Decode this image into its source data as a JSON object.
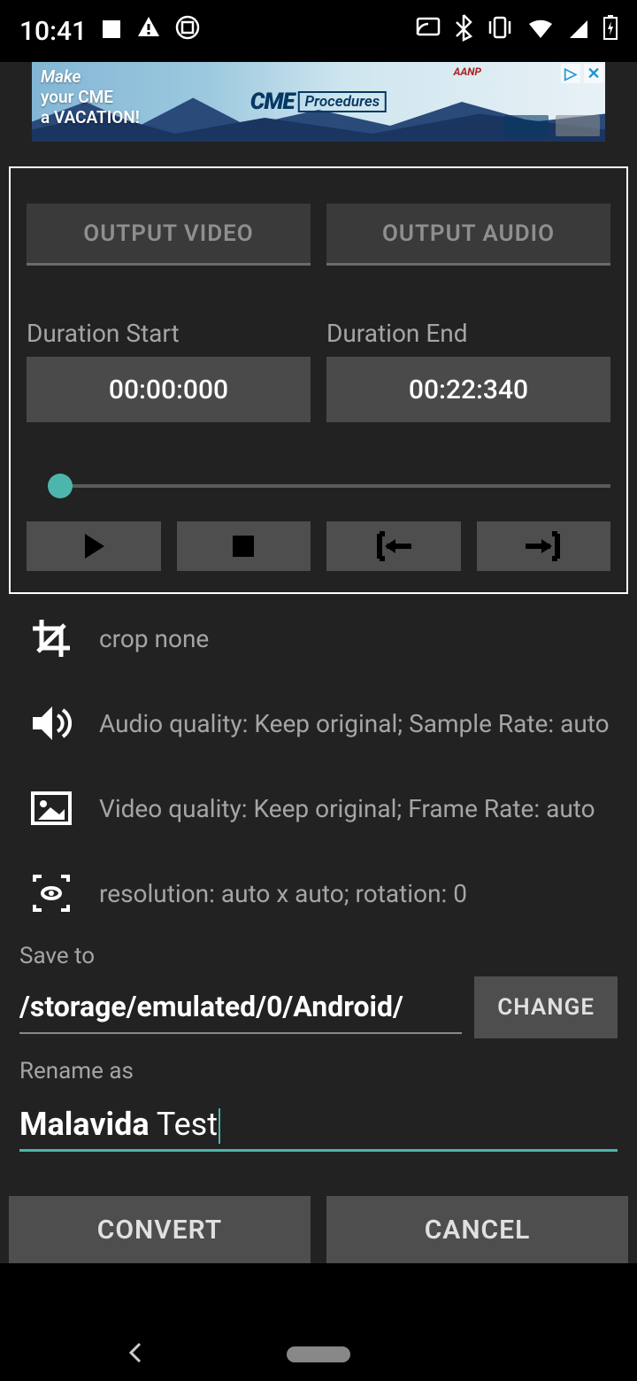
{
  "status": {
    "time": "10:41"
  },
  "ad": {
    "line1": "Make",
    "line2": "your CME",
    "line3": "a VACATION!",
    "brand1": "CME",
    "brand2": "Procedures",
    "aanp": "AANP"
  },
  "tabs": {
    "video": "OUTPUT VIDEO",
    "audio": "OUTPUT AUDIO"
  },
  "duration": {
    "start_label": "Duration Start",
    "end_label": "Duration End",
    "start": "00:00:000",
    "end": "00:22:340"
  },
  "options": {
    "crop": "crop none",
    "audio": "Audio quality: Keep original; Sample Rate: auto",
    "video": "Video quality: Keep original; Frame Rate: auto",
    "resolution": "resolution: auto x auto; rotation: 0"
  },
  "saveto": {
    "label": "Save to",
    "path": "/storage/emulated/0/Android/ ",
    "change": "CHANGE"
  },
  "rename": {
    "label": "Rename as",
    "value_bold": "Malavida",
    "value_rest": " Test"
  },
  "bottom": {
    "convert": "CONVERT",
    "cancel": "CANCEL"
  }
}
